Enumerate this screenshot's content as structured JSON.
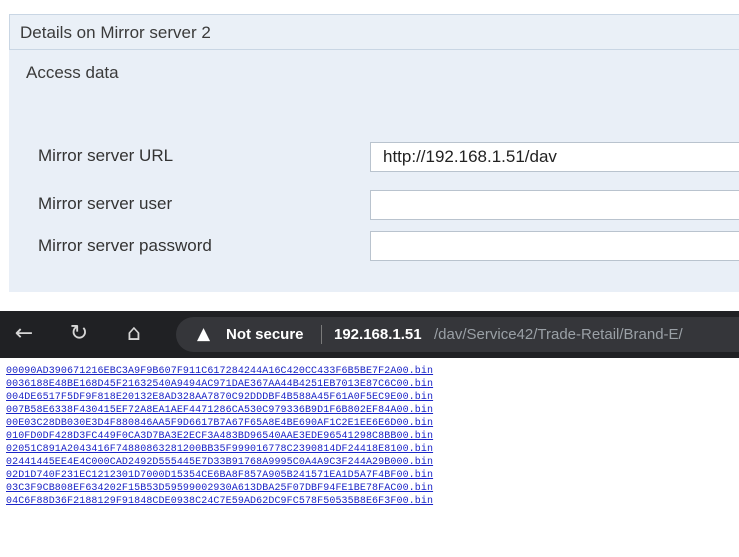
{
  "details": {
    "title": "Details on Mirror server 2",
    "section": "Access data",
    "fields": [
      {
        "label": "Mirror server URL",
        "value": "http://192.168.1.51/dav"
      },
      {
        "label": "Mirror server user",
        "value": ""
      },
      {
        "label": "Mirror server password",
        "value": ""
      }
    ]
  },
  "browser": {
    "security_label": "Not secure",
    "url_host": "192.168.1.51",
    "url_path": "/dav/Service42/Trade-Retail/Brand-E/",
    "files": [
      "00090AD390671216EBC3A9F9B607F911C617284244A16C420CC433F6B5BE7F2A00.bin",
      "0036188E48BE168D45F21632540A9494AC971DAE367AA44B4251EB7013E87C6C00.bin",
      "004DE6517F5DF9F818E20132E8AD328AA7870C92DDDBF4B588A45F61A0F5EC9E00.bin",
      "007B58E6338F430415EF72A8EA1AEF4471286CA530C979336B9D1F6B802EF84A00.bin",
      "00E03C28DB030E3D4F880846AA5F9D6617B7A67F65A8E4BE690AF1C2E1EE6E6D00.bin",
      "010FD0DF428D3FC449F0CA3D7BA3E2ECF3A483BD96540AAE3EDE96541298C8BB00.bin",
      "02051C891A2043416F74880863281200BB35F999016778C2390814DF24418E8100.bin",
      "02441445EE4E4C000CAD2492D555445E7D33B91768A9995C0A4A9C3F244A29B000.bin",
      "02D1D740F231EC1212301D7000D15354CE6BA8F857A905B241571EA1D5A7F4BF00.bin",
      "03C3F9CB808EF634202F15B53D59599002930A613DBA25F07DBF94FE1BE78FAC00.bin",
      "04C6F88D36F2188129F91848CDE0938C24C7E59AD62DC9FC578F50535B8E6F3F00.bin"
    ]
  },
  "colors": {
    "panel_bg": "#e9eff7",
    "toolbar_bg": "#202124",
    "link": "#1a24c7"
  }
}
